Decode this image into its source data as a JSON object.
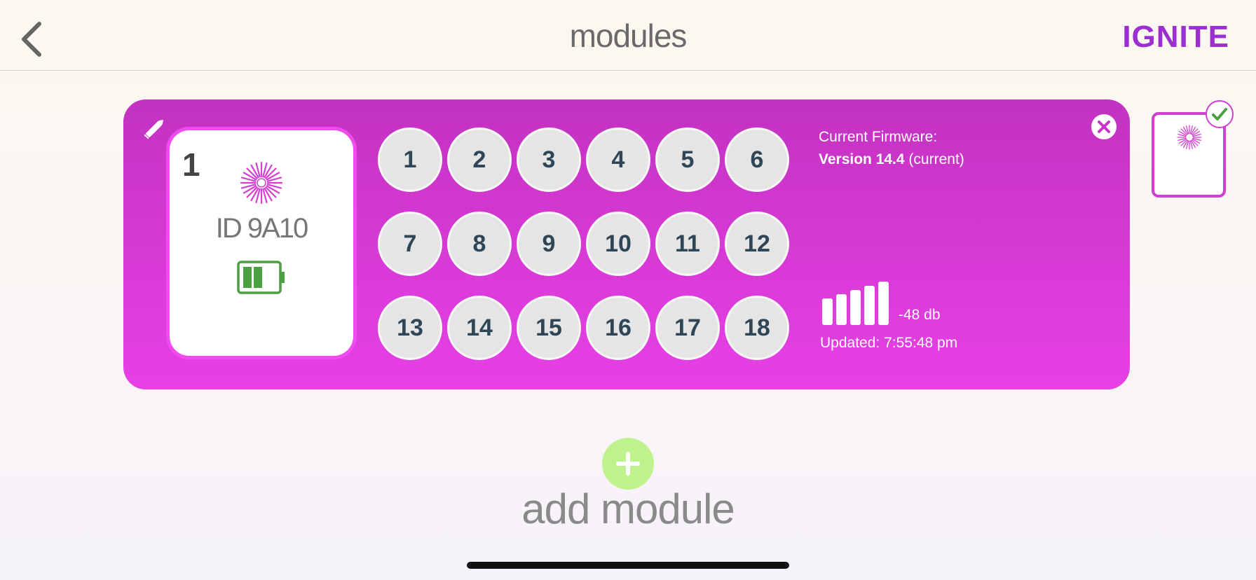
{
  "header": {
    "title": "modules",
    "brand": "IGNITE",
    "back_icon": "chevron-left-icon",
    "brand_color": "#9b2fd1"
  },
  "module": {
    "number": "1",
    "id_label": "ID 9A10",
    "battery_icon": "battery-icon",
    "battery_color": "#4aa040",
    "card_color_top": "#c232c0",
    "card_color_bottom": "#e640e6",
    "cues": [
      "1",
      "2",
      "3",
      "4",
      "5",
      "6",
      "7",
      "8",
      "9",
      "10",
      "11",
      "12",
      "13",
      "14",
      "15",
      "16",
      "17",
      "18"
    ],
    "firmware_label": "Current Firmware:",
    "firmware_version": "Version 14.4",
    "firmware_status": "(current)",
    "signal_db": "-48 db",
    "signal_level": 5,
    "updated": "Updated: 7:55:48 pm"
  },
  "thumbnail": {
    "selected": true,
    "check_color": "#4aa040"
  },
  "add": {
    "label": "add module",
    "button_color": "#bff28c"
  }
}
